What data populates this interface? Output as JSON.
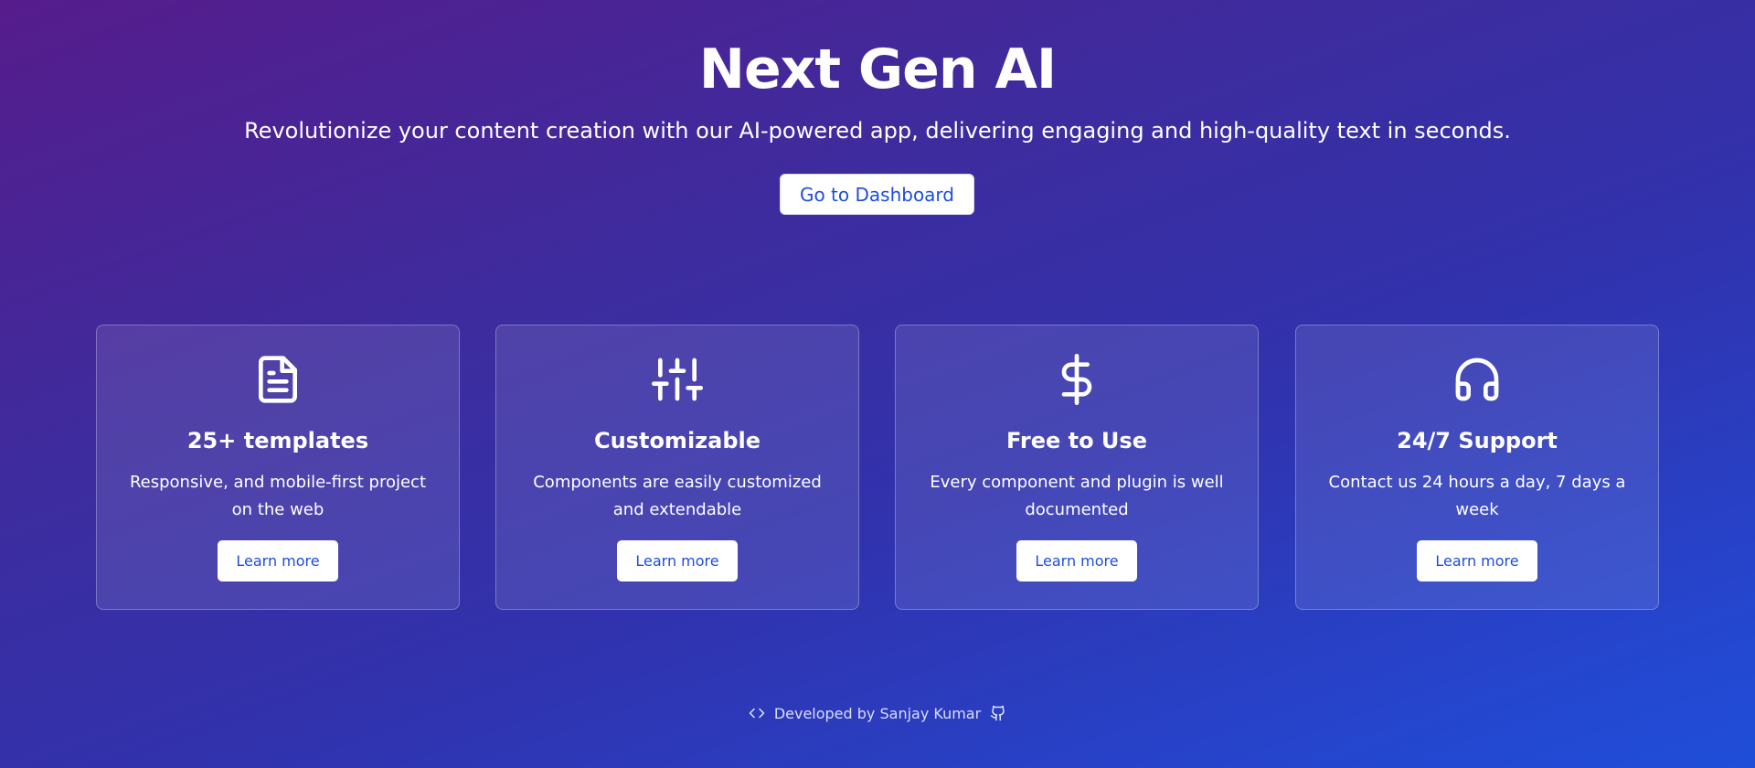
{
  "hero": {
    "title": "Next Gen AI",
    "subtitle": "Revolutionize your content creation with our AI-powered app, delivering engaging and high-quality text in seconds.",
    "cta_label": "Go to Dashboard"
  },
  "features": [
    {
      "icon": "file-text-icon",
      "title": "25+ templates",
      "description": "Responsive, and mobile-first project on the web",
      "button_label": "Learn more"
    },
    {
      "icon": "sliders-icon",
      "title": "Customizable",
      "description": "Components are easily customized and extendable",
      "button_label": "Learn more"
    },
    {
      "icon": "dollar-icon",
      "title": "Free to Use",
      "description": "Every component and plugin is well documented",
      "button_label": "Learn more"
    },
    {
      "icon": "headphones-icon",
      "title": "24/7 Support",
      "description": "Contact us 24 hours a day, 7 days a week",
      "button_label": "Learn more"
    }
  ],
  "footer": {
    "left_icon": "code-icon",
    "text": "Developed by Sanjay Kumar",
    "right_icon": "github-icon"
  },
  "colors": {
    "gradient_start": "#561c8c",
    "gradient_end": "#1f4ed8",
    "button_text": "#1d4ed8",
    "button_bg": "#ffffff"
  }
}
